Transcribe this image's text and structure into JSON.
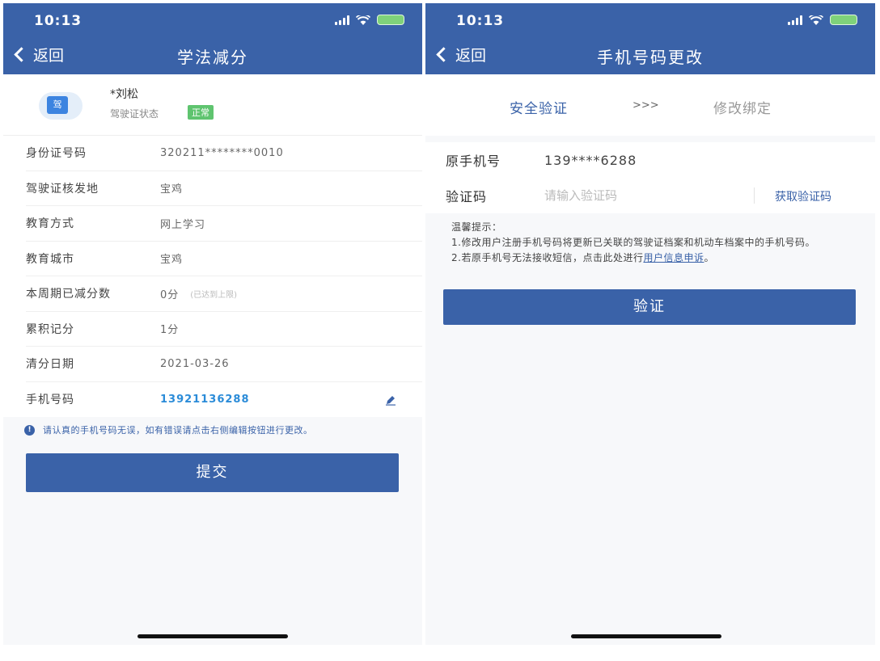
{
  "left": {
    "status": {
      "time": "10:13"
    },
    "nav": {
      "back": "返回",
      "title": "学法减分"
    },
    "profile": {
      "name": "*刘松",
      "status_label": "驾驶证状态",
      "status_badge": "正常"
    },
    "rows": [
      {
        "label": "身份证号码",
        "value": "320211********0010"
      },
      {
        "label": "驾驶证核发地",
        "value": "宝鸡"
      },
      {
        "label": "教育方式",
        "value": "网上学习"
      },
      {
        "label": "教育城市",
        "value": "宝鸡"
      },
      {
        "label": "本周期已减分数",
        "value": "0分",
        "extra": "(已达到上限)"
      },
      {
        "label": "累积记分",
        "value": "1分"
      },
      {
        "label": "清分日期",
        "value": "2021-03-26"
      },
      {
        "label": "手机号码",
        "value": "13921136288"
      }
    ],
    "notice": "请认真的手机号码无误，如有错误请点击右侧编辑按钮进行更改。",
    "submit": "提交"
  },
  "right": {
    "status": {
      "time": "10:13"
    },
    "nav": {
      "back": "返回",
      "title": "手机号码更改"
    },
    "steps": {
      "step1": "安全验证",
      "arrows": ">>>",
      "step2": "修改绑定"
    },
    "form": {
      "phone_label": "原手机号",
      "phone_value": "139****6288",
      "code_label": "验证码",
      "code_placeholder": "请输入验证码",
      "get_code": "获取验证码"
    },
    "tips": {
      "title": "温馨提示：",
      "line1": "1.修改用户注册手机号码将更新已关联的驾驶证档案和机动车档案中的手机号码。",
      "line2_prefix": "2.若原手机号无法接收短信，点击此处进行",
      "line2_link": "用户信息申诉",
      "line2_suffix": "。"
    },
    "verify": "验证"
  },
  "colors": {
    "brand": "#3a62a8",
    "accent_link": "#2a8bd8",
    "badge": "#5fc46f"
  }
}
